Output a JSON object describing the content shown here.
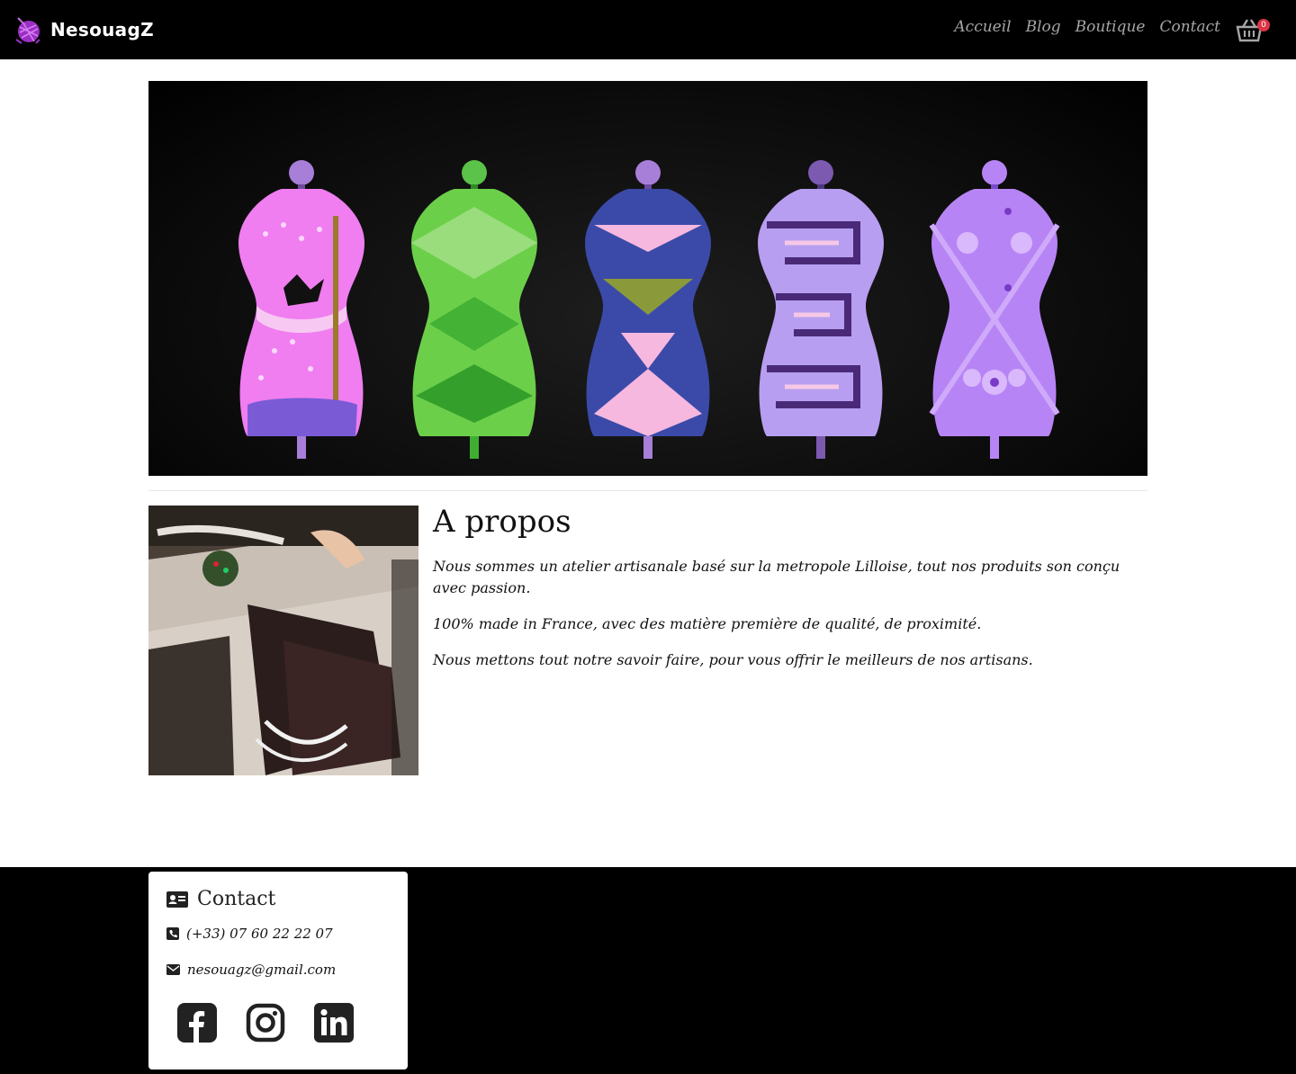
{
  "brand": {
    "name": "NesouagZ",
    "logo_icon": "yarn-ball-icon"
  },
  "nav": {
    "links": [
      {
        "label": "Accueil"
      },
      {
        "label": "Blog"
      },
      {
        "label": "Boutique"
      },
      {
        "label": "Contact"
      }
    ],
    "cart_count": "0",
    "cart_icon": "shopping-basket-icon"
  },
  "hero": {
    "image_description_icon": "mannequins-banner",
    "mannequin_colors": [
      "#f07ef0",
      "#6ccf4a",
      "#3b4aa8",
      "#b79ef0",
      "#b784f5"
    ]
  },
  "about": {
    "title": "A propos",
    "paragraphs": [
      "Nous sommes un atelier artisanale basé sur la metropole Lilloise, tout nos produits son conçu avec passion.",
      "100% made in France, avec des matière première de qualité, de proximité.",
      "Nous mettons tout notre savoir faire, pour vous offrir le meilleurs de nos artisans."
    ]
  },
  "footer": {
    "contact_title": "Contact",
    "phone": "(+33) 07 60 22 22 07",
    "email": "nesouagz@gmail.com",
    "socials": [
      "facebook-icon",
      "instagram-icon",
      "linkedin-icon"
    ]
  },
  "colors": {
    "navbar_bg": "#000000",
    "nav_link": "#a6a6a6",
    "badge": "#dc3545"
  }
}
